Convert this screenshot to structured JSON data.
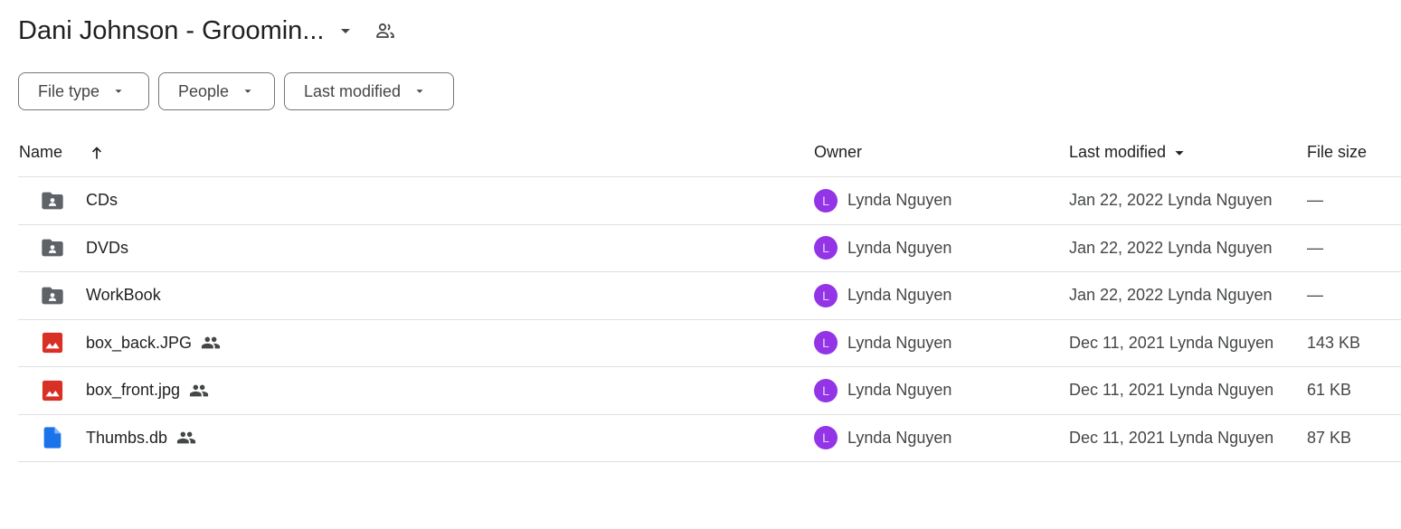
{
  "header": {
    "title": "Dani Johnson - Groomin...",
    "caret_icon": "arrow-drop-down-icon",
    "shared_icon": "people-outline-icon"
  },
  "filters": [
    {
      "label": "File type"
    },
    {
      "label": "People"
    },
    {
      "label": "Last modified"
    }
  ],
  "columns": {
    "name": "Name",
    "owner": "Owner",
    "last_modified": "Last modified",
    "file_size": "File size"
  },
  "colors": {
    "folder": "#5f6368",
    "image": "#d93025",
    "doc": "#1a73e8",
    "avatar": "#9334e6"
  },
  "files": [
    {
      "name": "CDs",
      "type": "shared-folder",
      "shared": false,
      "owner_initial": "L",
      "owner": "Lynda Nguyen",
      "modified": "Jan 22, 2022 Lynda Nguyen",
      "size": "—"
    },
    {
      "name": "DVDs",
      "type": "shared-folder",
      "shared": false,
      "owner_initial": "L",
      "owner": "Lynda Nguyen",
      "modified": "Jan 22, 2022 Lynda Nguyen",
      "size": "—"
    },
    {
      "name": "WorkBook",
      "type": "shared-folder",
      "shared": false,
      "owner_initial": "L",
      "owner": "Lynda Nguyen",
      "modified": "Jan 22, 2022 Lynda Nguyen",
      "size": "—"
    },
    {
      "name": "box_back.JPG",
      "type": "image",
      "shared": true,
      "owner_initial": "L",
      "owner": "Lynda Nguyen",
      "modified": "Dec 11, 2021 Lynda Nguyen",
      "size": "143 KB"
    },
    {
      "name": "box_front.jpg",
      "type": "image",
      "shared": true,
      "owner_initial": "L",
      "owner": "Lynda Nguyen",
      "modified": "Dec 11, 2021 Lynda Nguyen",
      "size": "61 KB"
    },
    {
      "name": "Thumbs.db",
      "type": "file",
      "shared": true,
      "owner_initial": "L",
      "owner": "Lynda Nguyen",
      "modified": "Dec 11, 2021 Lynda Nguyen",
      "size": "87 KB"
    }
  ]
}
